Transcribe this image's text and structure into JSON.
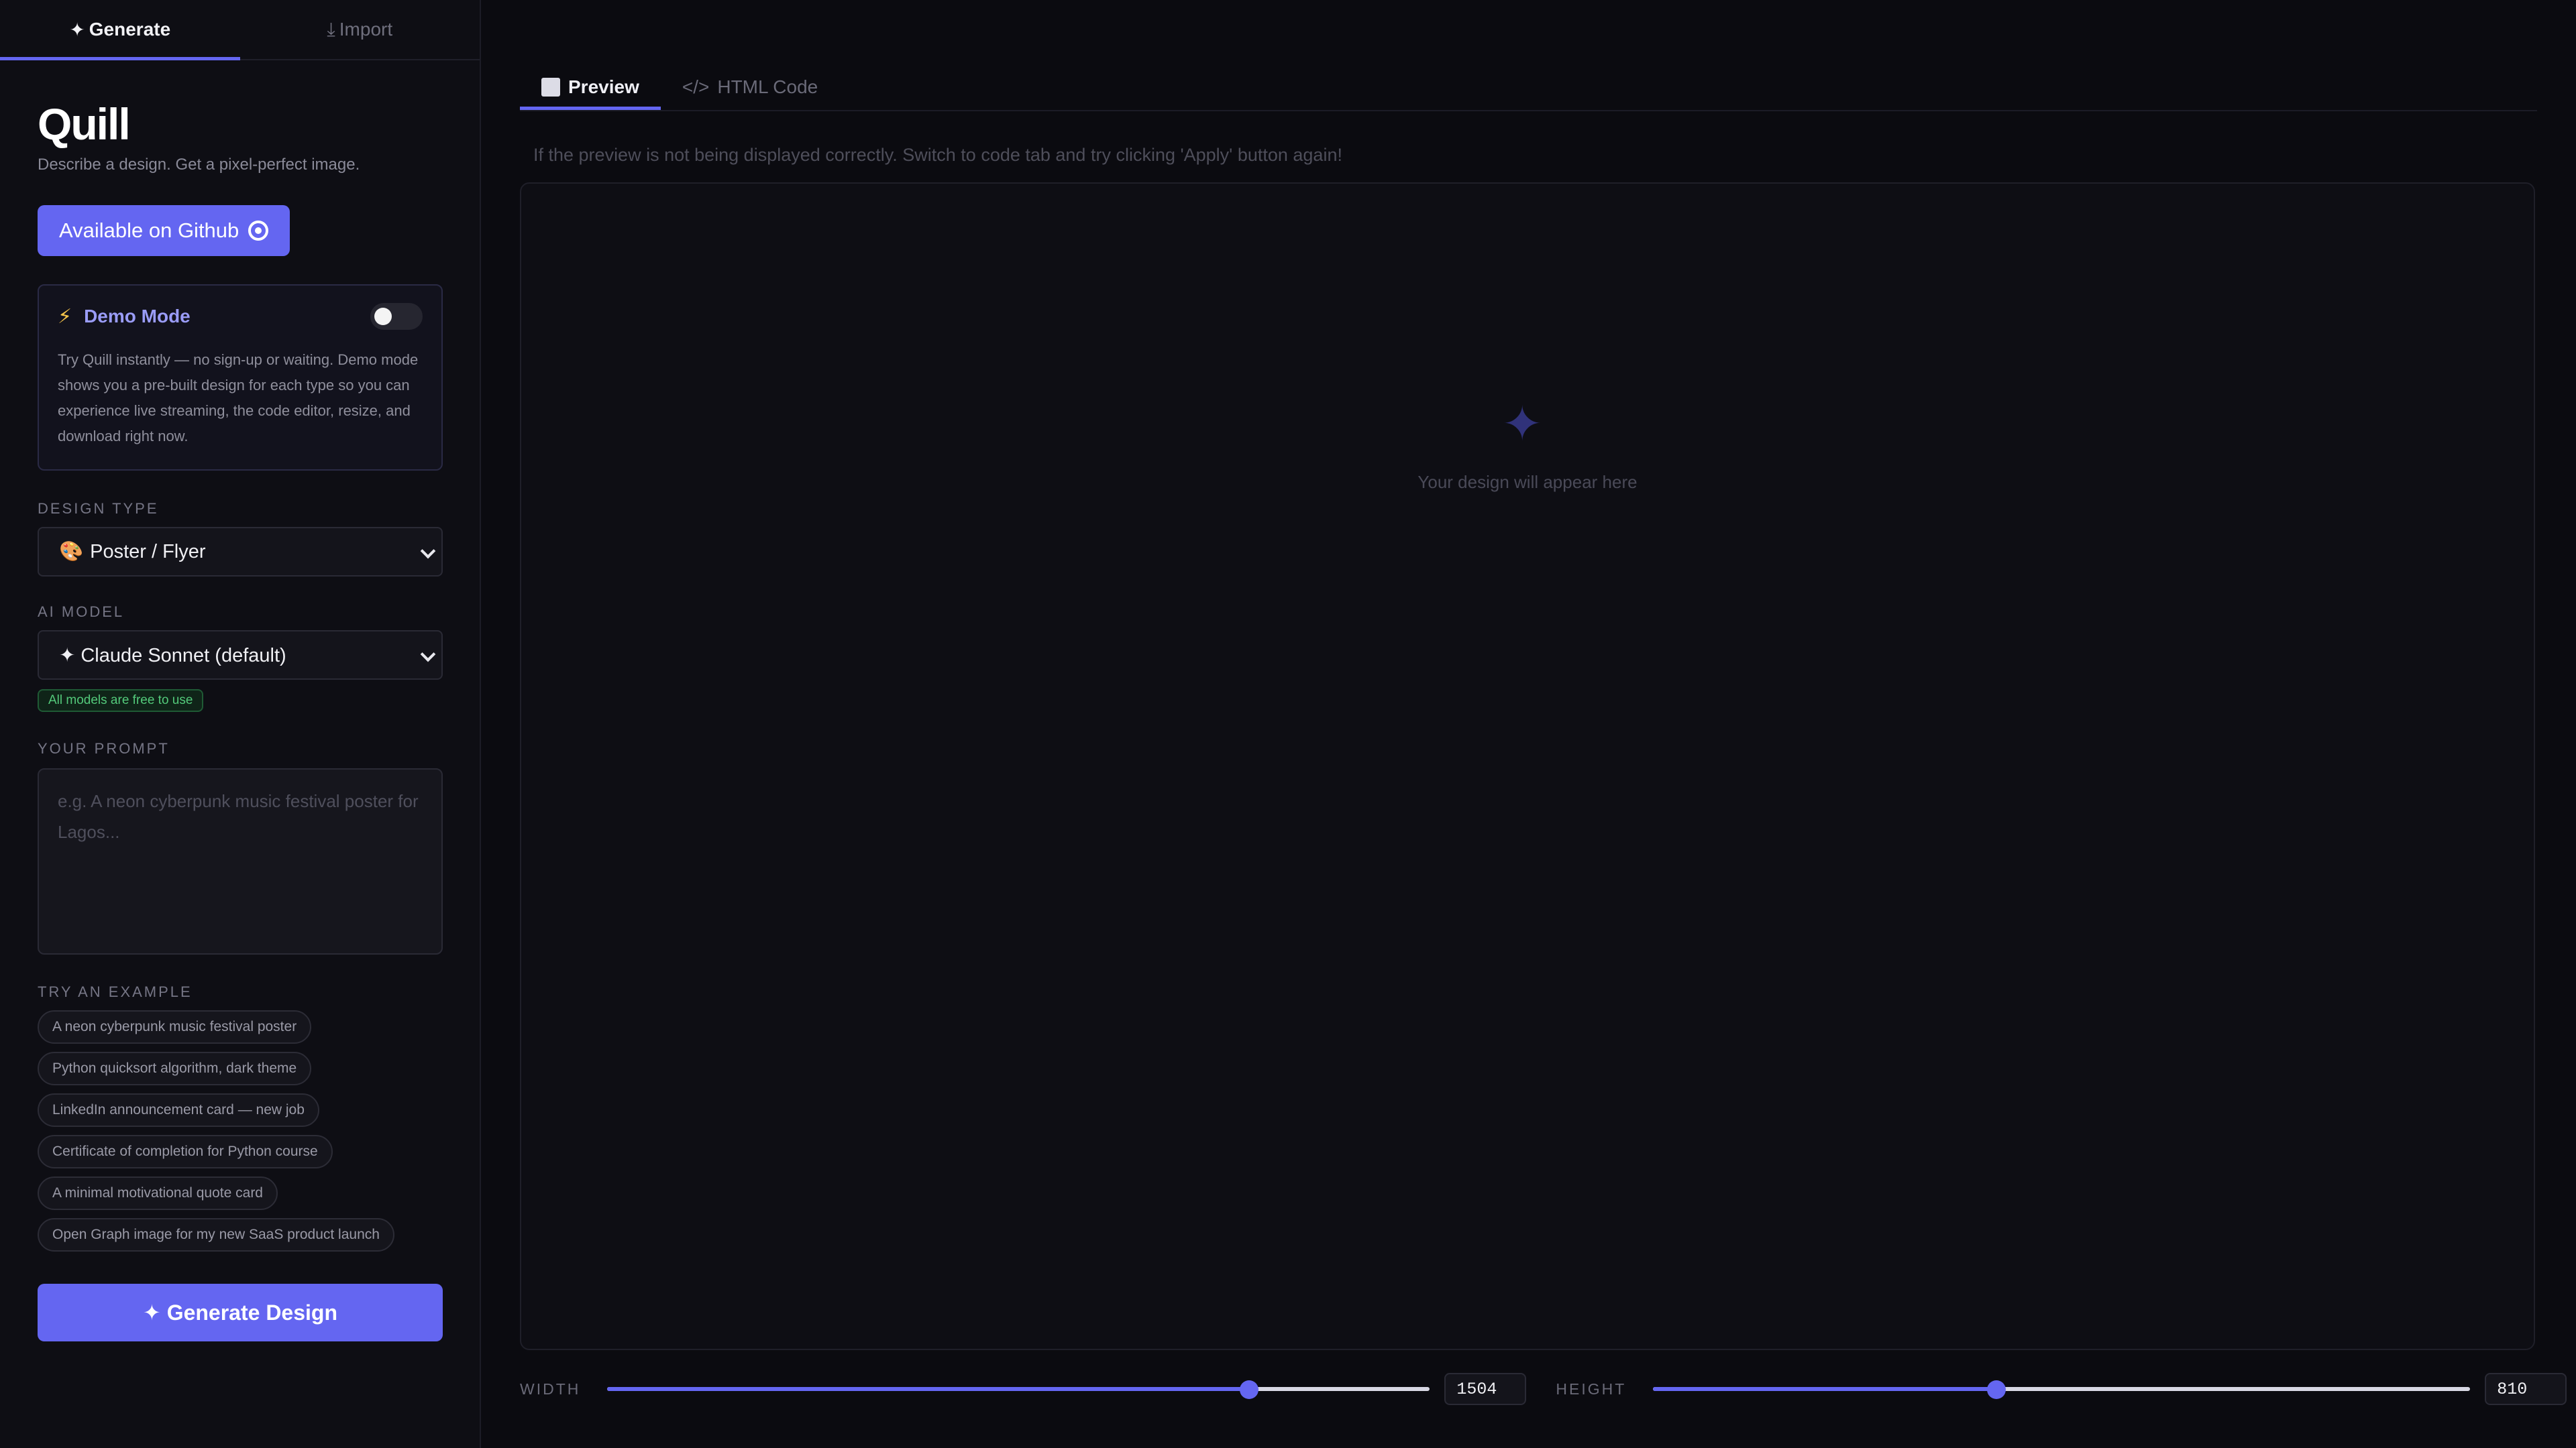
{
  "sidebar": {
    "tabs": [
      {
        "icon": "sparkle-icon",
        "glyph": "✦",
        "label": "Generate",
        "active": true
      },
      {
        "icon": "download-icon",
        "glyph": "⤓",
        "label": "Import",
        "active": false
      }
    ],
    "logo": "Quill",
    "tagline": "Describe a design. Get a pixel-perfect image.",
    "github_label": "Available on Github",
    "demo": {
      "title": "Demo Mode",
      "enabled": false,
      "description": "Try Quill instantly — no sign-up or waiting. Demo mode shows you a pre-built design for each type so you can experience live streaming, the code editor, resize, and download right now."
    },
    "design_type": {
      "label": "DESIGN TYPE",
      "emoji": "🎨",
      "value": "Poster / Flyer"
    },
    "ai_model": {
      "label": "AI MODEL",
      "value": "✦ Claude Sonnet (default)",
      "badge": "All models are free to use"
    },
    "prompt": {
      "label": "YOUR PROMPT",
      "placeholder": "e.g. A neon cyberpunk music festival poster for Lagos...",
      "value": ""
    },
    "examples": {
      "label": "TRY AN EXAMPLE",
      "items": [
        "A neon cyberpunk music festival poster",
        "Python quicksort algorithm, dark theme",
        "LinkedIn announcement card — new job",
        "Certificate of completion for Python course",
        "A minimal motivational quote card",
        "Open Graph image for my new SaaS product launch"
      ]
    },
    "generate_label": "✦ Generate Design"
  },
  "main": {
    "tabs": [
      {
        "label": "Preview",
        "active": true
      },
      {
        "label": "HTML Code",
        "prefix": "</>",
        "active": false
      }
    ],
    "hint": "If the preview is not being displayed correctly. Switch to code tab and try clicking 'Apply' button again!",
    "placeholder": "Your design will appear here",
    "width": {
      "label": "WIDTH",
      "value": "1504",
      "fraction": 0.78
    },
    "height": {
      "label": "HEIGHT",
      "value": "810",
      "fraction": 0.42
    }
  },
  "colors": {
    "accent": "#6466f1",
    "background": "#0b0b10",
    "success": "#53c97a"
  }
}
